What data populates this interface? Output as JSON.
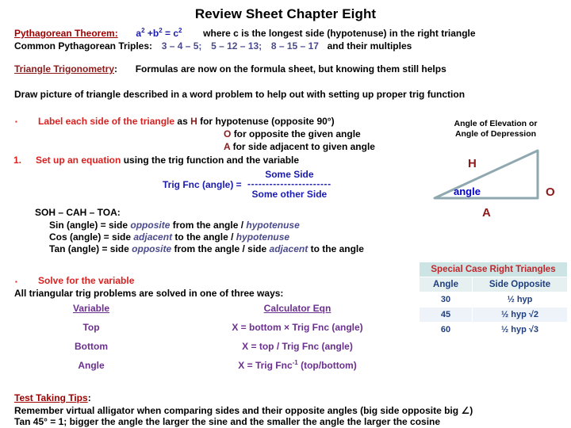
{
  "title": "Review Sheet Chapter Eight",
  "pythagorean": {
    "heading": "Pythagorean Theorem:",
    "formula_a": "a",
    "formula_sup1": "2",
    "formula_plus_b": " +b",
    "formula_sup2": "2",
    "formula_eq_c": " = c",
    "formula_sup3": "2",
    "note": "where c is the longest side (hypotenuse) in the right triangle",
    "triples_label": "Common Pythagorean Triples:",
    "triple_1": "3 – 4 – 5;",
    "triple_2": "5 – 12 – 13;",
    "triple_3": "8 – 15 – 17",
    "triples_suffix": "and their multiples"
  },
  "trigonometry": {
    "heading": "Triangle Trigonometry",
    "colon": ":",
    "note": "Formulas are now on the formula sheet, but knowing them still helps"
  },
  "draw_line": "Draw picture of triangle described in a word problem to help out with setting up proper trig function",
  "steps": {
    "bullet_glyph": "▪",
    "label_step_bold": "Label each side of the triangle",
    "label_step_rest": "as",
    "h_letter": "H",
    "h_text": "for hypotenuse (opposite 90°)",
    "o_letter": "O",
    "o_text": "for opposite the given angle",
    "a_letter": "A",
    "a_text": "for side adjacent to given angle",
    "number_1": "1.",
    "setup_bold": "Set up an equation",
    "setup_rest": "using the trig function and the variable"
  },
  "trig_fraction": {
    "lhs": "Trig Fnc (angle) =",
    "numerator": "Some Side",
    "bar": "-----------------------",
    "denominator": "Some other Side"
  },
  "sohcahtoa": {
    "header": "SOH – CAH – TOA:",
    "rows": [
      {
        "fn": "Sin (angle) = side",
        "w1": "opposite",
        "mid": "from the angle /",
        "w2": "hypotenuse",
        "tail": ""
      },
      {
        "fn": "Cos (angle) = side",
        "w1": "adjacent",
        "mid": "to the angle /",
        "w2": "hypotenuse",
        "tail": ""
      },
      {
        "fn": "Tan (angle) = side",
        "w1": "opposite",
        "mid": "from the angle / side",
        "w2": "adjacent",
        "tail": "to the angle"
      }
    ]
  },
  "solve": {
    "bullet_glyph": "▪",
    "bold": "Solve for the variable",
    "subtitle": "All triangular trig problems are solved in one of three ways:"
  },
  "var_table": {
    "header_left": "Variable",
    "header_right": "Calculator Eqn",
    "rows": [
      {
        "variable": "Top",
        "eqn_pre": "X = bottom × Trig Fnc (angle)",
        "sup": "",
        "eqn_post": ""
      },
      {
        "variable": "Bottom",
        "eqn_pre": "X = top / Trig Fnc (angle)",
        "sup": "",
        "eqn_post": ""
      },
      {
        "variable": "Angle",
        "eqn_pre": "X = Trig Fnc",
        "sup": "-1",
        "eqn_post": " (top/bottom)"
      }
    ]
  },
  "diagram": {
    "caption_line1": "Angle of Elevation or",
    "caption_line2": "Angle of Depression",
    "label_h": "H",
    "label_o": "O",
    "label_a": "A",
    "label_angle": "angle",
    "stroke_color": "#8FA8B0"
  },
  "special_table": {
    "header": "Special Case Right Triangles",
    "col_angle": "Angle",
    "col_side": "Side Opposite",
    "rows": [
      {
        "angle": "30",
        "side": "½ hyp"
      },
      {
        "angle": "45",
        "side": "½ hyp √2"
      },
      {
        "angle": "60",
        "side": "½ hyp √3"
      }
    ]
  },
  "tips": {
    "heading": "Test Taking Tips",
    "colon": ":",
    "line1": "Remember virtual alligator when comparing sides and their opposite angles (big side opposite big ∠)",
    "line2": "Tan 45° = 1;   bigger the angle the larger the sine and the smaller the angle the larger the cosine"
  }
}
